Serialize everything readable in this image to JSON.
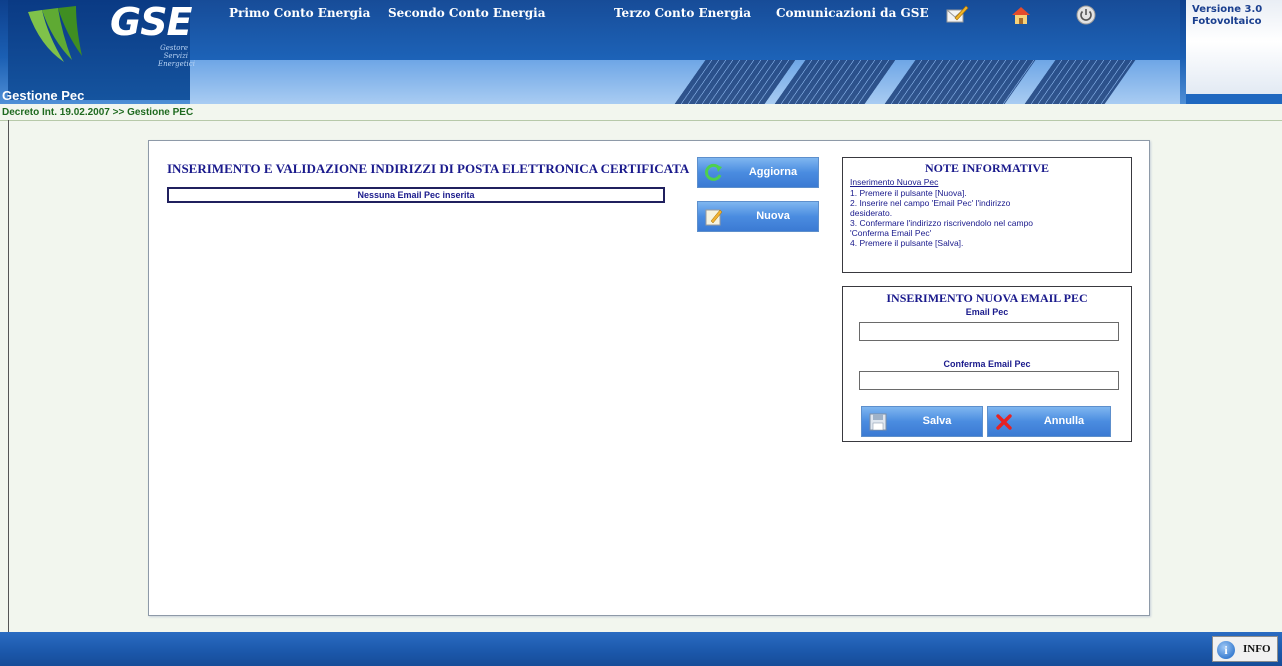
{
  "header": {
    "logo_text": "GSE",
    "logo_subtitle": [
      "Gestore",
      "Servizi",
      "Energetici"
    ],
    "nav": [
      {
        "label": "Primo Conto Energia"
      },
      {
        "label": "Secondo Conto Energia"
      },
      {
        "label": "Terzo Conto Energia"
      },
      {
        "label": "Comunicazioni da GSE"
      }
    ],
    "icons": [
      "edit-message-icon",
      "home-icon",
      "power-icon"
    ],
    "version_line1": "Versione 3.0",
    "version_line2": "Fotovoltaico",
    "page_subtitle": "Gestione Pec"
  },
  "breadcrumb": "Decreto Int. 19.02.2007 >> Gestione PEC",
  "main": {
    "title": "INSERIMENTO E VALIDAZIONE INDIRIZZI DI POSTA ELETTRONICA CERTIFICATA",
    "empty_message": "Nessuna Email Pec inserita",
    "buttons": {
      "refresh_label": "Aggiorna",
      "new_label": "Nuova"
    }
  },
  "notes": {
    "title": "NOTE INFORMATIVE",
    "subtitle": "Inserimento Nuova Pec",
    "lines": [
      "1. Premere il pulsante [Nuova].",
      "2. Inserire nel campo 'Email Pec' l'indirizzo",
      "desiderato.",
      "3. Confermare l'indirizzo riscrivendolo nel campo",
      "'Conferma Email Pec'",
      "4. Premere il pulsante [Salva]."
    ]
  },
  "insert": {
    "title": "INSERIMENTO NUOVA EMAIL PEC",
    "email_label": "Email Pec",
    "email_value": "",
    "confirm_label": "Conferma Email Pec",
    "confirm_value": "",
    "save_label": "Salva",
    "cancel_label": "Annulla"
  },
  "footer": {
    "info_label": "INFO"
  },
  "colors": {
    "header_blue": "#1b5fb3",
    "title_blue": "#1a1a8c",
    "breadcrumb_green": "#1f6a20",
    "button_blue": "#4a8ce0"
  }
}
